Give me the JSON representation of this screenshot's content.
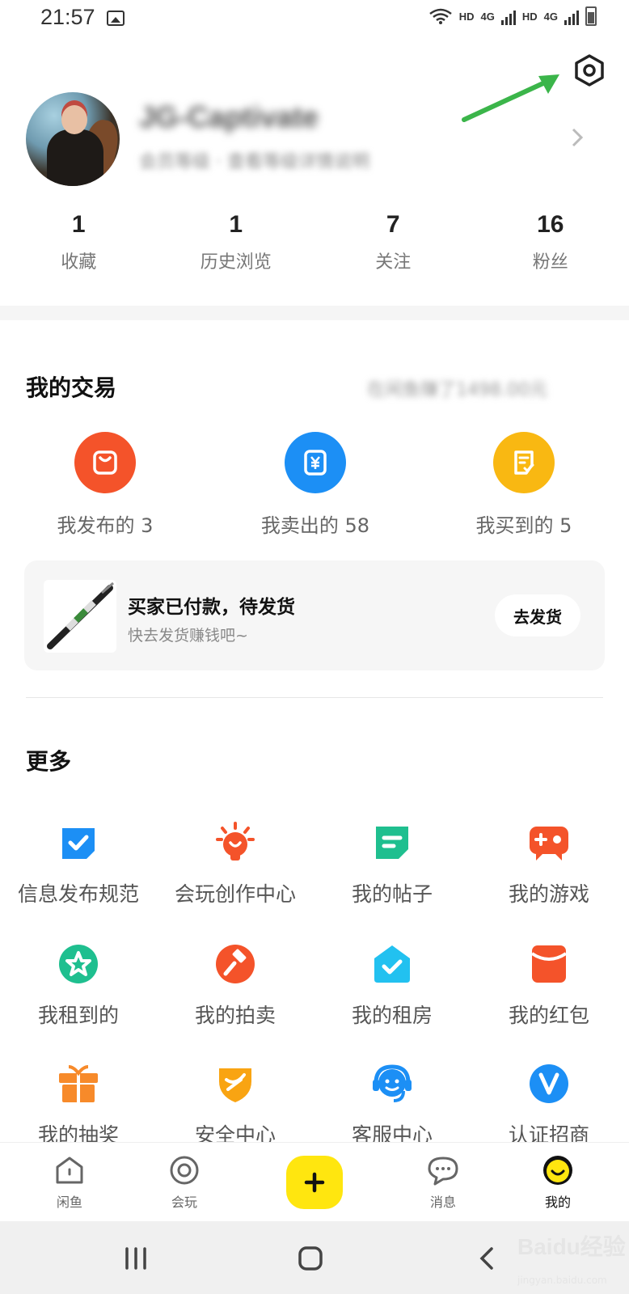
{
  "status_bar": {
    "time": "21:57",
    "hd1": "HD",
    "net1": "4G",
    "hd2": "HD",
    "net2": "4G"
  },
  "profile": {
    "name": "JG-Captivate",
    "subtitle": "会员等级 · 查看等级详情说明"
  },
  "stats": [
    {
      "value": "1",
      "label": "收藏"
    },
    {
      "value": "1",
      "label": "历史浏览"
    },
    {
      "value": "7",
      "label": "关注"
    },
    {
      "value": "16",
      "label": "粉丝"
    }
  ],
  "trade": {
    "title": "我的交易",
    "right_text": "在闲鱼赚了1498.00元",
    "items": [
      {
        "label": "我发布的 3",
        "icon": "bag-icon",
        "color": "#f4532a"
      },
      {
        "label": "我卖出的 58",
        "icon": "yuan-icon",
        "color": "#1c8ff5"
      },
      {
        "label": "我买到的 5",
        "icon": "receipt-icon",
        "color": "#f9b812"
      }
    ],
    "order": {
      "title": "买家已付款，待发货",
      "subtitle": "快去发货赚钱吧~",
      "button": "去发货"
    }
  },
  "more": {
    "title": "更多",
    "items": [
      {
        "label": "信息发布规范",
        "icon": "rules-check-icon",
        "color": "#1c8ff5"
      },
      {
        "label": "会玩创作中心",
        "icon": "lightbulb-icon",
        "color": "#f4532a"
      },
      {
        "label": "我的帖子",
        "icon": "post-icon",
        "color": "#1fbf8f"
      },
      {
        "label": "我的游戏",
        "icon": "gamepad-icon",
        "color": "#f4532a"
      },
      {
        "label": "我租到的",
        "icon": "rent-star-icon",
        "color": "#1fbf8f"
      },
      {
        "label": "我的拍卖",
        "icon": "auction-hammer-icon",
        "color": "#f4532a"
      },
      {
        "label": "我的租房",
        "icon": "house-check-icon",
        "color": "#22c1f0"
      },
      {
        "label": "我的红包",
        "icon": "red-packet-icon",
        "color": "#f4532a"
      },
      {
        "label": "我的抽奖",
        "icon": "gift-icon",
        "color": "#f78a2a"
      },
      {
        "label": "安全中心",
        "icon": "shield-icon",
        "color": "#f9a412"
      },
      {
        "label": "客服中心",
        "icon": "customer-service-icon",
        "color": "#1c8ff5"
      },
      {
        "label": "认证招商",
        "icon": "verified-v-icon",
        "color": "#1c8ff5"
      }
    ]
  },
  "bottom_nav": [
    {
      "label": "闲鱼",
      "icon": "home-icon"
    },
    {
      "label": "会玩",
      "icon": "play-circle-icon"
    },
    {
      "label": "",
      "icon": "plus-icon"
    },
    {
      "label": "消息",
      "icon": "message-icon"
    },
    {
      "label": "我的",
      "icon": "smile-icon"
    }
  ],
  "watermark": {
    "text": "Baidu经验",
    "sub": "jingyan.baidu.com"
  },
  "colors": {
    "accent_yellow": "#ffe60f",
    "annotation_green": "#3bb54a"
  }
}
